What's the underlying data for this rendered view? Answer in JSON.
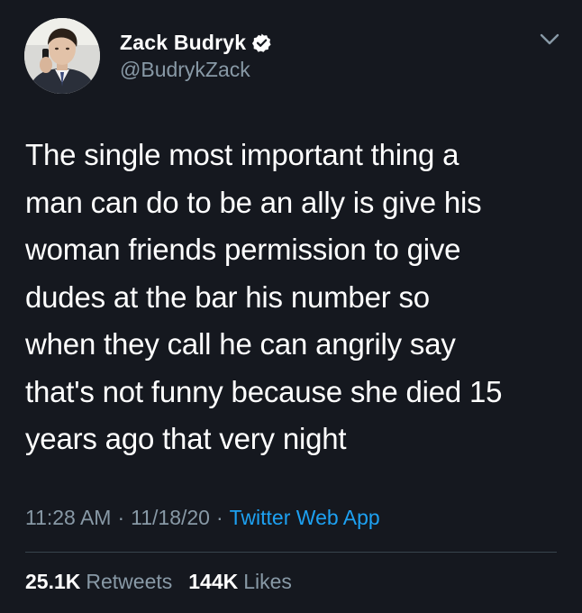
{
  "author": {
    "display_name": "Zack Budryk",
    "handle": "@BudrykZack",
    "verified": true
  },
  "tweet": {
    "text": "The single most important thing a\nman can do to be an ally is give his\nwoman friends permission to give\ndudes at the bar his number so\nwhen they call he can angrily say\nthat's not funny because she died 15\nyears ago that very night"
  },
  "meta": {
    "time": "11:28 AM",
    "date": "11/18/20",
    "separator": "·",
    "source": "Twitter Web App"
  },
  "stats": {
    "retweets_count": "25.1K",
    "retweets_label": "Retweets",
    "likes_count": "144K",
    "likes_label": "Likes"
  },
  "icons": {
    "verified": "verified-badge-icon",
    "menu": "chevron-down-icon"
  },
  "colors": {
    "background": "#15181f",
    "text": "#ffffff",
    "secondary_text": "#8899a6",
    "link": "#1da1f2",
    "divider": "#38444d"
  }
}
